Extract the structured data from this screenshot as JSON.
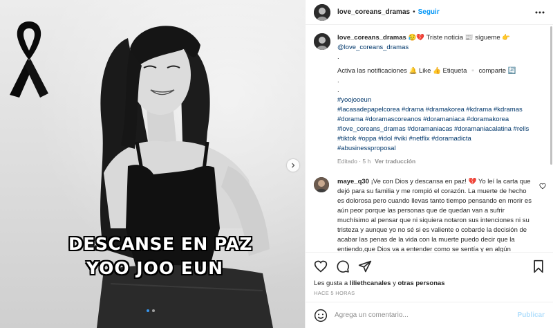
{
  "media": {
    "banner_line1": "DESCANSE EN PAZ",
    "banner_line2": "YOO JOO EUN",
    "carousel_dots": 2,
    "active_dot": 0
  },
  "header": {
    "username": "love_coreans_dramas",
    "separator": "•",
    "follow_label": "Seguir"
  },
  "caption": {
    "username": "love_coreans_dramas",
    "text_line1": " 😥💔 Triste noticia 📰 sígueme 👉",
    "mention": "@love_coreans_dramas",
    "dot1": ".",
    "notify_line": "Activa las notificaciones 🔔 Like 👍 Etiqueta ▫️ comparte 🔄",
    "dot2": ".",
    "dot3": ".",
    "hashtags": [
      "#yoojooeun",
      "#lacasadepapelcorea #drama #dramakorea #kdrama #kdramas",
      "#dorama #doramascoreanos #doramaniaca #doramakorea",
      "#love_coreans_dramas #doramaniacas #doramaniacalatina #rells",
      "#tiktok #oppa #idol #viki #netflix #doramadicta",
      "#abusinessproposal"
    ],
    "meta_time": "Editado · 5 h",
    "meta_translate": "Ver traducción"
  },
  "comment": {
    "username": "maye_q30",
    "text": " ¡Ve con Dios y descansa en paz! 💔 Yo leí la carta que dejó para su familia y me rompió el corazón. La muerte de hecho es dolorosa pero cuando llevas tanto tiempo pensando en morir es aún peor porque las personas que de quedan van a sufrir muchísimo al pensar que ni siquiera notaron sus intenciones ni su tristeza y aunque yo no sé si es valiente o cobarde la decisión de acabar las penas de la vida con la muerte puedo decir que la entiendo,que Dios va a entender como se sentía y en algún momento su familia va a"
  },
  "likes": {
    "prefix": "Les gusta a ",
    "user": "liliethcanales",
    "middle": " y ",
    "others": "otras personas"
  },
  "timestamp": "HACE 5 HORAS",
  "add_comment": {
    "placeholder": "Agrega un comentario...",
    "publish_label": "Publicar"
  },
  "icons": [
    "more-icon",
    "heart-icon",
    "comment-icon",
    "share-icon",
    "bookmark-icon",
    "emoji-icon",
    "chevron-right-icon",
    "black-ribbon-icon"
  ],
  "colors": {
    "accent": "#0095f6",
    "link": "#00376b",
    "muted": "#8e8e8e",
    "publish_disabled": "#b2dffc",
    "comment_heart": "#ed4956"
  }
}
